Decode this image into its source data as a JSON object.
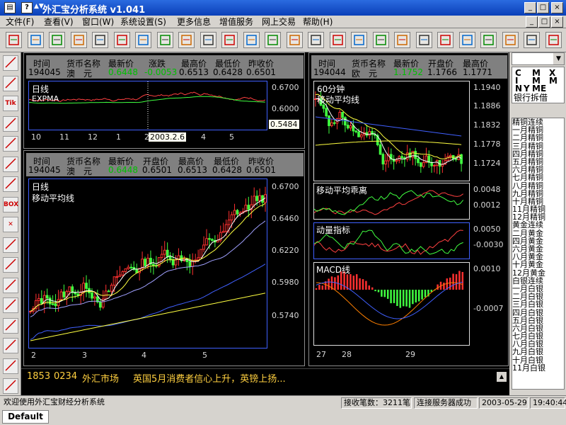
{
  "window": {
    "title": "外汇宝分析系统 v1.041",
    "icon1": "▤",
    "icon2": "?",
    "min": "_",
    "max": "□",
    "close": "×"
  },
  "menu": [
    "文件(F)",
    "查看(V)",
    "窗口(W)",
    "系统设置(S)",
    "更多信息",
    "增值服务",
    "网上交易",
    "帮助(H)"
  ],
  "mdi_buttons": {
    "min": "_",
    "max": "□",
    "close": "×"
  },
  "toolbar_icons": [
    "new-icon",
    "open-icon",
    "copy-icon",
    "paste-icon",
    "print-icon",
    "grid-icon",
    "cut-icon",
    "chart-icon",
    "window-icon",
    "layout-icon",
    "binoculars-icon",
    "page-icon",
    "text-icon",
    "up-down-icon",
    "table-icon",
    "clock-icon",
    "ref-icon",
    "sort-icon",
    "news-icon",
    "list-icon",
    "arrow-icon",
    "panel-icon",
    "warning-icon",
    "flag-icon",
    "dropdown-icon",
    "calculator-icon"
  ],
  "left_tools": [
    "line-tool-icon",
    "ray-tool-icon",
    "tik-tool-icon",
    "parallel-tool-icon",
    "trend-tool-icon",
    "channel-tool-icon",
    "cycle-tool-icon",
    "box-tool-icon",
    "delete-tool-icon",
    "eraser-tool-icon",
    "point-tool-icon",
    "wave-tool-icon",
    "zoom-in-icon",
    "zoom-out-icon",
    "fan-tool-icon",
    "bars-tool-icon",
    "rect-tool-icon"
  ],
  "left_tool_labels": {
    "tik": "Tik",
    "box": "BOX",
    "x": "✕"
  },
  "panel_top_left": {
    "headers": [
      "时间",
      "货币名称",
      "最新价",
      "涨跌",
      "最高价",
      "最低价",
      "昨收价"
    ],
    "values": [
      "194045",
      "澳　元",
      "0.6448",
      "-0.0053",
      "0.6513",
      "0.6428",
      "0.6501"
    ],
    "chart_label": "日线",
    "indicator": "EXPMA",
    "y_ticks": [
      "0.6700",
      "0.6000",
      "0.5484"
    ],
    "x_ticks": [
      "10",
      "11",
      "12",
      "1",
      "2",
      "3",
      "4",
      "5"
    ],
    "cursor_date": "2003.2.6"
  },
  "panel_bottom_left": {
    "headers": [
      "时间",
      "货币名称",
      "最新价",
      "开盘价",
      "最高价",
      "最低价",
      "昨收价"
    ],
    "values": [
      "194045",
      "澳　元",
      "0.6448",
      "0.6501",
      "0.6513",
      "0.6428",
      "0.6501"
    ],
    "chart_label": "日线",
    "indicator": "移动平均线",
    "y_ticks": [
      "0.6700",
      "0.6460",
      "0.6220",
      "0.5980",
      "0.5740"
    ],
    "x_ticks": [
      "2",
      "3",
      "4",
      "5"
    ]
  },
  "panel_right": {
    "headers": [
      "时间",
      "货币名称",
      "最新价",
      "开盘价",
      "最高价"
    ],
    "values": [
      "194044",
      "欧　元",
      "1.1752",
      "1.1766",
      "1.1771"
    ],
    "chart_label": "60分钟",
    "indicator": "移动平均线",
    "y_ticks": [
      "1.1940",
      "1.1886",
      "1.1832",
      "1.1778",
      "1.1724"
    ],
    "sub1": {
      "label": "移动平均乖离",
      "ticks": [
        "0.0048",
        "0.0012"
      ]
    },
    "sub2": {
      "label": "动量指标",
      "ticks": [
        "0.0050",
        "-0.0030"
      ]
    },
    "sub3": {
      "label": "MACD线",
      "ticks": [
        "0.0010",
        "-0.0007"
      ]
    },
    "x_ticks": [
      "27",
      "28",
      "29"
    ]
  },
  "news": {
    "time1": "1853",
    "time2": "0234",
    "source": "外汇市场",
    "text": "英国5月消费者信心上升，英镑上扬..."
  },
  "right_panel": {
    "letters": [
      "C",
      "M",
      "X",
      "I",
      "M",
      "M",
      "N",
      "Y",
      "M",
      "E"
    ],
    "header": "银行拆借",
    "items": [
      "精铜连续",
      "一月精铜",
      "二月精铜",
      "三月精铜",
      "四月精铜",
      "五月精铜",
      "六月精铜",
      "七月精铜",
      "八月精铜",
      "九月精铜",
      "十月精铜",
      "11月精铜",
      "12月精铜",
      "黄金连续",
      "二月黄金",
      "四月黄金",
      "六月黄金",
      "八月黄金",
      "十月黄金",
      "12月黄金",
      "白银连续",
      "一月白银",
      "二月白银",
      "三月白银",
      "四月白银",
      "五月白银",
      "六月白银",
      "七月白银",
      "八月白银",
      "九月白银",
      "十月白银",
      "11月白银"
    ]
  },
  "status": {
    "welcome": "欢迎使用外汇宝财经分析系统",
    "count": "接收笔数：3211笔",
    "server": "连接服务器成功",
    "date": "2003-05-29",
    "time": "19:40:44"
  },
  "tab": "Default",
  "colors": {
    "up": "#ff3030",
    "down": "#40ff40",
    "latest": "#00cc00",
    "panel_border": "#4060ff"
  }
}
